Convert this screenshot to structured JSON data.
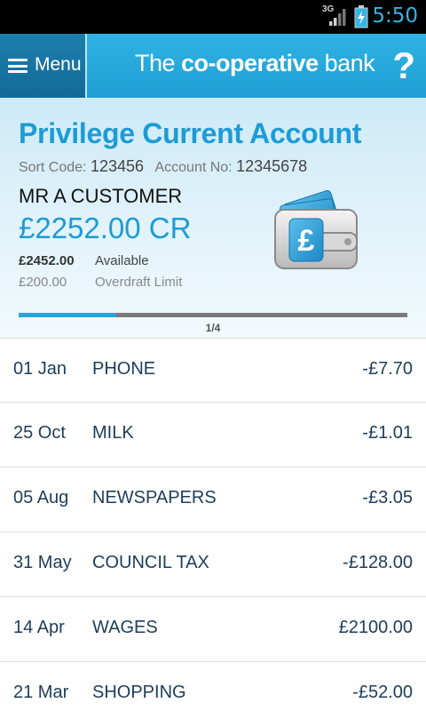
{
  "status_bar": {
    "network": "3G",
    "time": "5:50",
    "icons": [
      "signal-icon",
      "battery-charging-icon"
    ]
  },
  "header": {
    "menu_label": "Menu",
    "brand_prefix": "The ",
    "brand_bold": "co-operative",
    "brand_suffix": " bank",
    "help_label": "?"
  },
  "account": {
    "title": "Privilege Current Account",
    "sort_code_label": "Sort Code:",
    "sort_code": "123456",
    "account_no_label": "Account No:",
    "account_no": "12345678",
    "holder": "MR A CUSTOMER",
    "balance": "£2252.00 CR",
    "available_amount": "£2452.00",
    "available_label": "Available",
    "overdraft_amount": "£200.00",
    "overdraft_label": "Overdraft Limit",
    "icon": "wallet-pound-icon",
    "pager": {
      "current": 1,
      "total": 4,
      "text": "1/4"
    }
  },
  "transactions": [
    {
      "date": "01 Jan",
      "description": "PHONE",
      "amount": "-£7.70"
    },
    {
      "date": "25 Oct",
      "description": "MILK",
      "amount": "-£1.01"
    },
    {
      "date": "05 Aug",
      "description": "NEWSPAPERS",
      "amount": "-£3.05"
    },
    {
      "date": "31 May",
      "description": "COUNCIL TAX",
      "amount": "-£128.00"
    },
    {
      "date": "14 Apr",
      "description": "WAGES",
      "amount": "£2100.00"
    },
    {
      "date": "21 Mar",
      "description": "SHOPPING",
      "amount": "-£52.00"
    }
  ],
  "colors": {
    "accent": "#1d9bd6",
    "header": "#2fb2e3",
    "menu": "#1d7fae",
    "status_time": "#33b5e5"
  }
}
